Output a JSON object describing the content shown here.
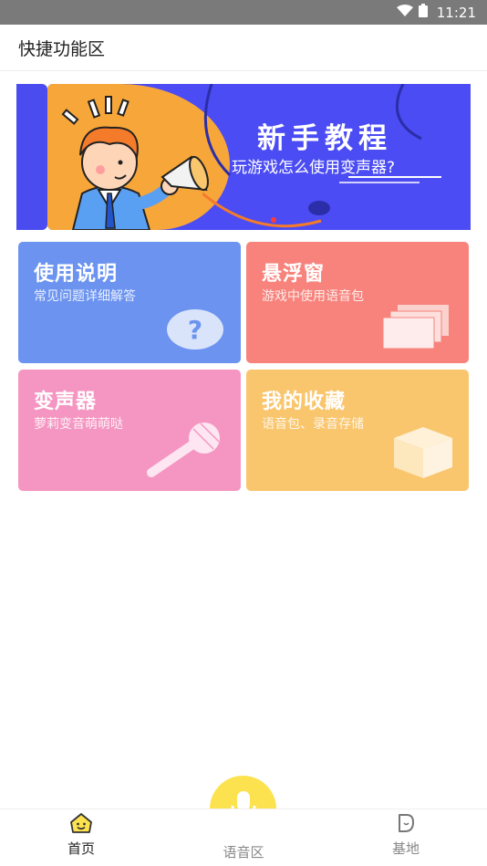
{
  "status_bar": {
    "time": "11:21",
    "icons": [
      "wifi-icon",
      "battery-icon"
    ]
  },
  "app_bar": {
    "title": "快捷功能区"
  },
  "banner": {
    "headline": "新手教程",
    "subline": "玩游戏怎么使用变声器?"
  },
  "cards": [
    {
      "title": "使用说明",
      "subtitle": "常见问题详细解答",
      "icon": "question-icon",
      "color": "#6b93ef"
    },
    {
      "title": "悬浮窗",
      "subtitle": "游戏中使用语音包",
      "icon": "windows-icon",
      "color": "#f7837c"
    },
    {
      "title": "变声器",
      "subtitle": "萝莉变音萌萌哒",
      "icon": "microphone-icon",
      "color": "#f596c2"
    },
    {
      "title": "我的收藏",
      "subtitle": "语音包、录音存储",
      "icon": "box-icon",
      "color": "#f9c66e"
    }
  ],
  "tab_bar": {
    "home": "首页",
    "voice": "语音区",
    "base": "基地",
    "center_button_color": "#fde24f"
  }
}
